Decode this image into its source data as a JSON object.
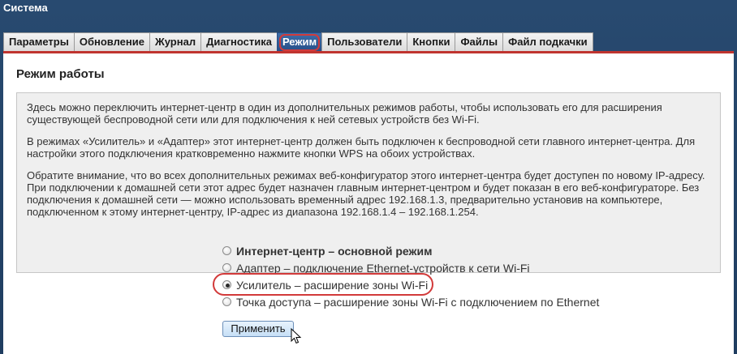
{
  "header": {
    "title": "Система"
  },
  "tabs": [
    {
      "label": "Параметры",
      "active": false
    },
    {
      "label": "Обновление",
      "active": false
    },
    {
      "label": "Журнал",
      "active": false
    },
    {
      "label": "Диагностика",
      "active": false
    },
    {
      "label": "Режим",
      "active": true
    },
    {
      "label": "Пользователи",
      "active": false
    },
    {
      "label": "Кнопки",
      "active": false
    },
    {
      "label": "Файлы",
      "active": false
    },
    {
      "label": "Файл подкачки",
      "active": false
    }
  ],
  "section": {
    "title": "Режим работы",
    "paragraphs": [
      "Здесь можно переключить интернет-центр в один из дополнительных режимов работы, чтобы использовать его для расширения существующей беспроводной сети или для подключения к ней сетевых устройств без Wi-Fi.",
      "В режимах «Усилитель» и «Адаптер» этот интернет-центр должен быть подключен к беспроводной сети главного интернет-центра. Для настройки этого подключения кратковременно нажмите кнопки WPS на обоих устройствах.",
      "Обратите внимание, что во всех дополнительных режимах веб-конфигуратор этого интернет-центра будет доступен по новому IP-адресу. При подключении к домашней сети этот адрес будет назначен главным интернет-центром и будет показан в его веб-конфигураторе. Без подключения к домашней сети — можно использовать временный адрес 192.168.1.3, предварительно установив на компьютере, подключенном к этому интернет-центру, IP-адрес из диапазона 192.168.1.4 – 192.168.1.254."
    ]
  },
  "modes": [
    {
      "label": "Интернет-центр – основной режим",
      "checked": false
    },
    {
      "label": "Адаптер – подключение Ethernet-устройств к сети Wi-Fi",
      "checked": false
    },
    {
      "label": "Усилитель – расширение зоны Wi-Fi",
      "checked": true
    },
    {
      "label": "Точка доступа – расширение зоны Wi-Fi с подключением по Ethernet",
      "checked": false
    }
  ],
  "apply_label": "Применить",
  "colors": {
    "background": "#284a70",
    "active_tab": "#3f6ea8",
    "accent_red": "#c0342f",
    "highlight": "#d23a3a"
  }
}
